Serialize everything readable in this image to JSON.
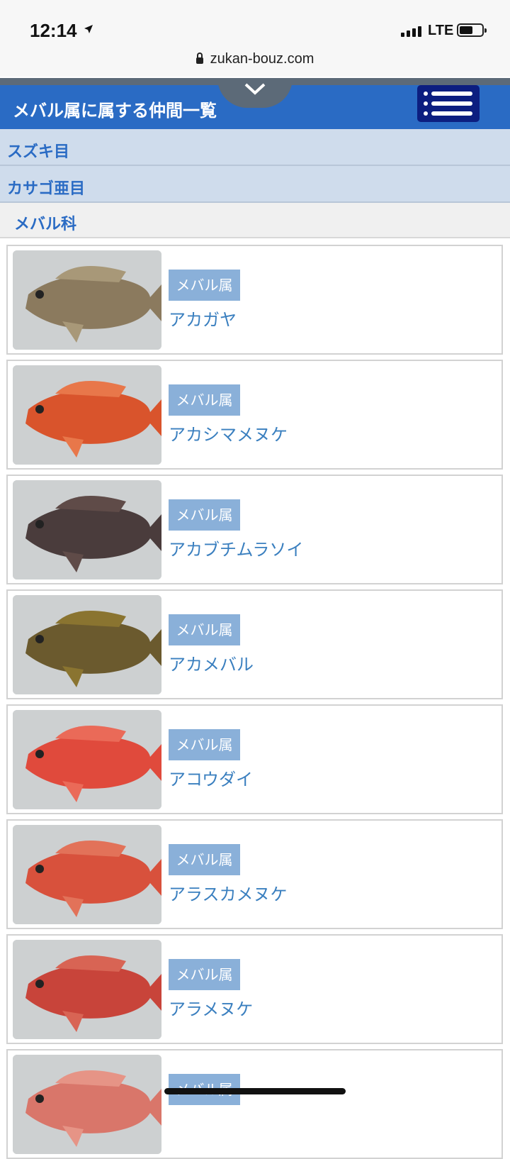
{
  "status": {
    "time": "12:14",
    "network": "LTE"
  },
  "browser": {
    "url": "zukan-bouz.com"
  },
  "header": {
    "title": "メバル属に属する仲間一覧"
  },
  "breadcrumb": {
    "order": "スズキ目",
    "suborder": "カサゴ亜目",
    "family": "メバル科"
  },
  "fish": [
    {
      "tag": "メバル属",
      "name": "アカガヤ",
      "body": "#8b7a5e",
      "fin": "#a89878"
    },
    {
      "tag": "メバル属",
      "name": "アカシマメヌケ",
      "body": "#d9542c",
      "fin": "#e8774a"
    },
    {
      "tag": "メバル属",
      "name": "アカブチムラソイ",
      "body": "#4a3c3c",
      "fin": "#5f4b48"
    },
    {
      "tag": "メバル属",
      "name": "アカメバル",
      "body": "#6b5a2e",
      "fin": "#8a7430"
    },
    {
      "tag": "メバル属",
      "name": "アコウダイ",
      "body": "#e04a3c",
      "fin": "#ea6a58"
    },
    {
      "tag": "メバル属",
      "name": "アラスカメヌケ",
      "body": "#d8513c",
      "fin": "#e27259"
    },
    {
      "tag": "メバル属",
      "name": "アラメヌケ",
      "body": "#c8443a",
      "fin": "#d86454"
    },
    {
      "tag": "メバル属",
      "name": "",
      "body": "#d9766a",
      "fin": "#e69486"
    }
  ]
}
